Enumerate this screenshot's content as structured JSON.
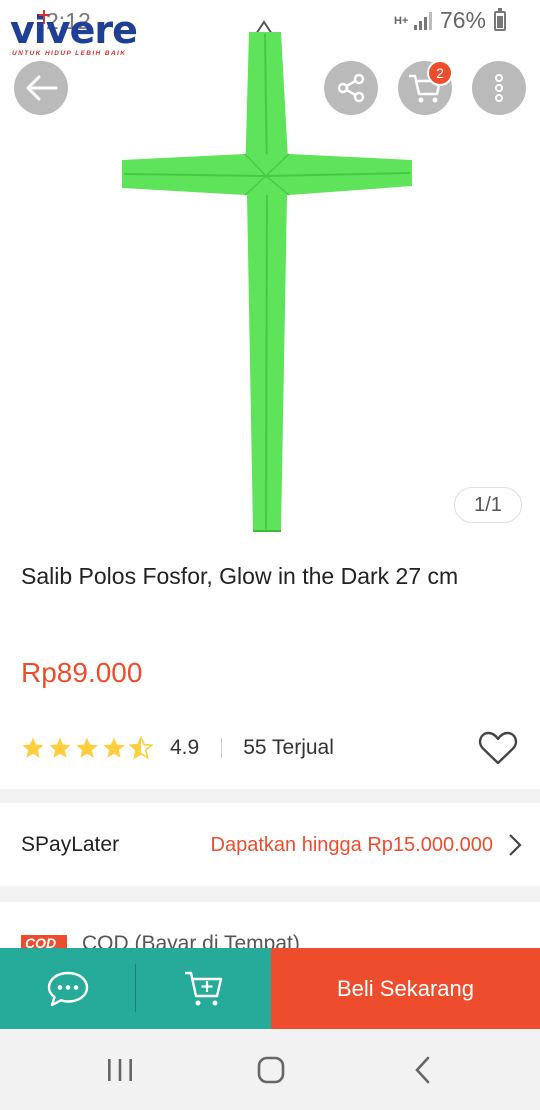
{
  "status_bar": {
    "time": "2:12",
    "network": "H+",
    "battery": "76%"
  },
  "brand": {
    "name": "vivere",
    "tagline": "UNTUK HIDUP LEBIH BAIK"
  },
  "header": {
    "cart_count": "2"
  },
  "gallery": {
    "counter": "1/1"
  },
  "product": {
    "title": "Salib Polos Fosfor, Glow in the Dark 27 cm",
    "price": "Rp89.000",
    "rating": "4.9",
    "rating_stars": 4.5,
    "sold": "55 Terjual"
  },
  "paylater": {
    "label": "SPayLater",
    "offer": "Dapatkan hingga Rp15.000.000"
  },
  "cod": {
    "badge": "COD",
    "label": "COD (Bayar di Tempat)"
  },
  "actions": {
    "buy_now": "Beli Sekarang"
  },
  "colors": {
    "accent": "#ee4d2d",
    "teal": "#26aa99",
    "star": "#ffce3d",
    "product_green": "#5fe35a"
  },
  "icons": {
    "back": "arrow-left-icon",
    "share": "share-icon",
    "cart": "cart-icon",
    "more": "more-vertical-icon",
    "favorite": "heart-outline-icon",
    "chat": "chat-icon",
    "add_to_cart": "cart-plus-icon",
    "chevron": "chevron-right-icon"
  }
}
